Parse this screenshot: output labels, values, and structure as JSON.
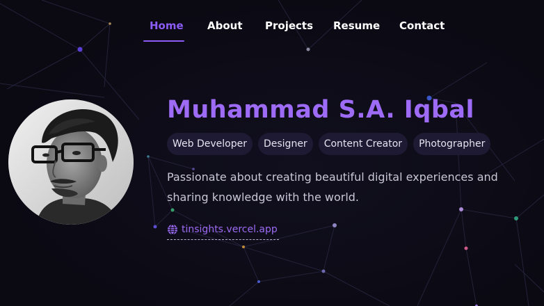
{
  "nav": {
    "items": [
      {
        "label": "Home",
        "active": true
      },
      {
        "label": "About",
        "active": false
      },
      {
        "label": "Projects",
        "active": false
      },
      {
        "label": "Resume",
        "active": false
      },
      {
        "label": "Contact",
        "active": false
      }
    ],
    "active_color": "#8b5cf6"
  },
  "profile": {
    "name": "Muhammad S.A. Iqbal",
    "tags": [
      "Web Developer",
      "Designer",
      "Content Creator",
      "Photographer"
    ],
    "bio": "Passionate about creating beautiful digital experiences and sharing knowledge with the world.",
    "website": {
      "label": "tinsights.vercel.app",
      "icon": "globe-icon"
    },
    "avatar": {
      "style": "black-and-white portrait photo"
    }
  },
  "colors": {
    "background": "#0b0a13",
    "accent": "#9d6bf5",
    "tag_background": "#1f1a33",
    "text": "#ffffff"
  }
}
